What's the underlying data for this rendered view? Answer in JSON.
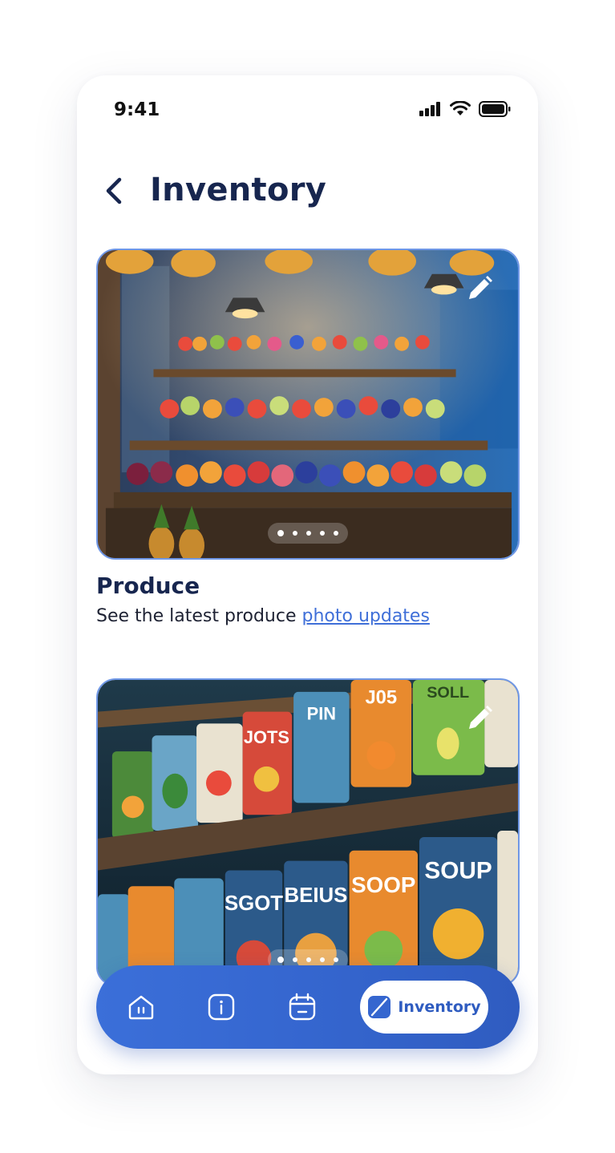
{
  "status_bar": {
    "time": "9:41"
  },
  "header": {
    "title": "Inventory"
  },
  "cards": [
    {
      "title": "Produce",
      "description_prefix": "See the latest produce",
      "link_text": "photo updates",
      "image": "fruit-market-stall",
      "carousel": {
        "pages": 5,
        "active": 1
      }
    },
    {
      "image": "canned-goods-shelves",
      "carousel": {
        "pages": 5,
        "active": 1
      }
    }
  ],
  "bottom_nav": {
    "items": [
      {
        "icon": "home-icon"
      },
      {
        "icon": "info-icon"
      },
      {
        "icon": "calendar-icon"
      },
      {
        "icon": "inventory-icon",
        "label": "Inventory",
        "active": true
      }
    ]
  },
  "colors": {
    "title": "#17264f",
    "accent": "#3b6fd9",
    "link": "#3f6fd8",
    "card_border": "#6f97e6"
  },
  "can_labels": {
    "top": [
      "JOTS",
      "PIN",
      "J05",
      "SOLL"
    ],
    "bottom": [
      "SGOT",
      "BEIUS",
      "SOOP",
      "SOUP"
    ]
  }
}
